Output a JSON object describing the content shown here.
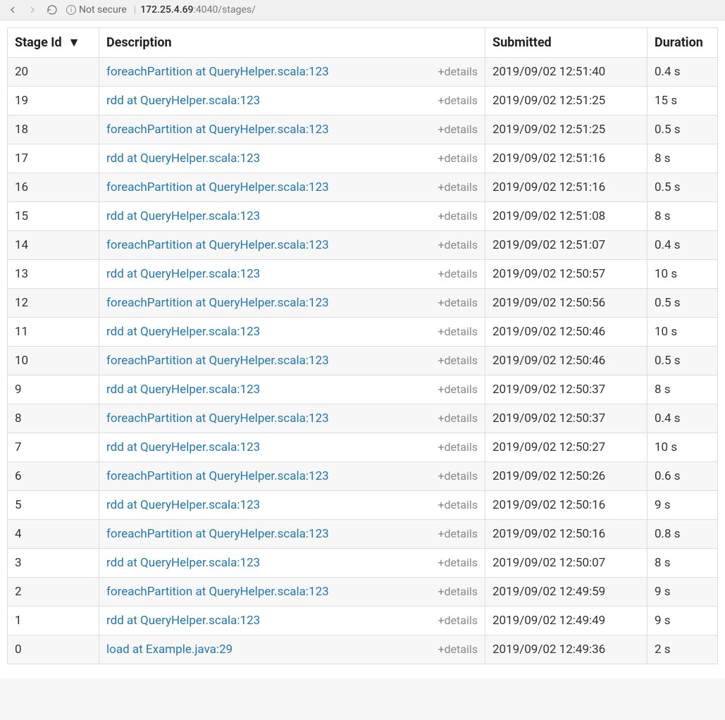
{
  "browser": {
    "security_label": "Not secure",
    "url_host": "172.25.4.69",
    "url_port": ":4040",
    "url_path": "/stages/"
  },
  "table": {
    "headers": {
      "stage_id": "Stage Id",
      "sort_indicator": "▼",
      "description": "Description",
      "submitted": "Submitted",
      "duration": "Duration"
    },
    "details_label": "+details",
    "rows": [
      {
        "id": "20",
        "desc": "foreachPartition at QueryHelper.scala:123",
        "submitted": "2019/09/02 12:51:40",
        "duration": "0.4 s"
      },
      {
        "id": "19",
        "desc": "rdd at QueryHelper.scala:123",
        "submitted": "2019/09/02 12:51:25",
        "duration": "15 s"
      },
      {
        "id": "18",
        "desc": "foreachPartition at QueryHelper.scala:123",
        "submitted": "2019/09/02 12:51:25",
        "duration": "0.5 s"
      },
      {
        "id": "17",
        "desc": "rdd at QueryHelper.scala:123",
        "submitted": "2019/09/02 12:51:16",
        "duration": "8 s"
      },
      {
        "id": "16",
        "desc": "foreachPartition at QueryHelper.scala:123",
        "submitted": "2019/09/02 12:51:16",
        "duration": "0.5 s"
      },
      {
        "id": "15",
        "desc": "rdd at QueryHelper.scala:123",
        "submitted": "2019/09/02 12:51:08",
        "duration": "8 s"
      },
      {
        "id": "14",
        "desc": "foreachPartition at QueryHelper.scala:123",
        "submitted": "2019/09/02 12:51:07",
        "duration": "0.4 s"
      },
      {
        "id": "13",
        "desc": "rdd at QueryHelper.scala:123",
        "submitted": "2019/09/02 12:50:57",
        "duration": "10 s"
      },
      {
        "id": "12",
        "desc": "foreachPartition at QueryHelper.scala:123",
        "submitted": "2019/09/02 12:50:56",
        "duration": "0.5 s"
      },
      {
        "id": "11",
        "desc": "rdd at QueryHelper.scala:123",
        "submitted": "2019/09/02 12:50:46",
        "duration": "10 s"
      },
      {
        "id": "10",
        "desc": "foreachPartition at QueryHelper.scala:123",
        "submitted": "2019/09/02 12:50:46",
        "duration": "0.5 s"
      },
      {
        "id": "9",
        "desc": "rdd at QueryHelper.scala:123",
        "submitted": "2019/09/02 12:50:37",
        "duration": "8 s"
      },
      {
        "id": "8",
        "desc": "foreachPartition at QueryHelper.scala:123",
        "submitted": "2019/09/02 12:50:37",
        "duration": "0.4 s"
      },
      {
        "id": "7",
        "desc": "rdd at QueryHelper.scala:123",
        "submitted": "2019/09/02 12:50:27",
        "duration": "10 s"
      },
      {
        "id": "6",
        "desc": "foreachPartition at QueryHelper.scala:123",
        "submitted": "2019/09/02 12:50:26",
        "duration": "0.6 s"
      },
      {
        "id": "5",
        "desc": "rdd at QueryHelper.scala:123",
        "submitted": "2019/09/02 12:50:16",
        "duration": "9 s"
      },
      {
        "id": "4",
        "desc": "foreachPartition at QueryHelper.scala:123",
        "submitted": "2019/09/02 12:50:16",
        "duration": "0.8 s"
      },
      {
        "id": "3",
        "desc": "rdd at QueryHelper.scala:123",
        "submitted": "2019/09/02 12:50:07",
        "duration": "8 s"
      },
      {
        "id": "2",
        "desc": "foreachPartition at QueryHelper.scala:123",
        "submitted": "2019/09/02 12:49:59",
        "duration": "9 s"
      },
      {
        "id": "1",
        "desc": "rdd at QueryHelper.scala:123",
        "submitted": "2019/09/02 12:49:49",
        "duration": "9 s"
      },
      {
        "id": "0",
        "desc": "load at Example.java:29",
        "submitted": "2019/09/02 12:49:36",
        "duration": "2 s"
      }
    ]
  }
}
